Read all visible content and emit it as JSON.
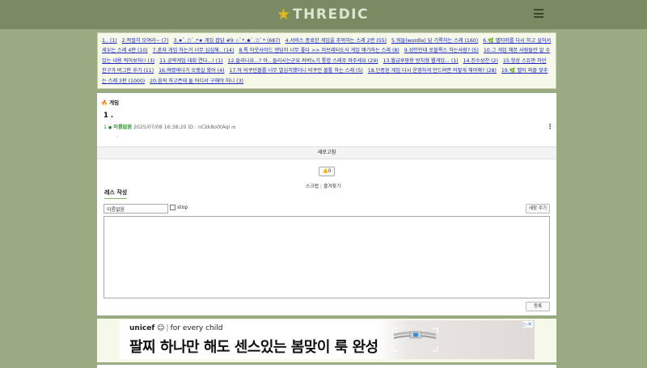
{
  "header": {
    "site_name": "THREDIC",
    "logo_icon": "star-icon",
    "menu_icon": "hamburger-icon"
  },
  "thread_list": [
    "1.. (1)",
    "2.적절히 모여라~ (7)",
    "3.★ﾟ.☆ﾟ.*★ 게임 잡담 #9 ☆ﾟ*.★ﾟ.☆ﾟ* (687)",
    "4.서비스 종료한 게임을 추억하는 스레 2판 (55)",
    "5.워들(wordle) 답 기록하는 스레 (160)",
    "6.🌿 멜티떠를 다시 하고 싶어서 세우는 스레 4판 (10)",
    "7.혼자 게임 하는거 너무 심심해.. (14)",
    "8.톡 아웃사이드 엔딩이 너무 좋다 >> 러브레터도식 게임 얘기하는 스레 (8)",
    "9.성인인데 로블록스 하는사람? (5)",
    "10.그 게임 해본 사람들만 알 수 있는 내용 적어보자!! (3)",
    "11.공략게임 대회 연다...! (1)",
    "12.들리나요...? 아.. 들리시는군요 커버노기 통합 스레로 와주세요 (29)",
    "13.월급루팡용 방치형 웹게임... (1)",
    "14.진수성찬 (2)",
    "15.항상 스듀판 하던 친구가 버그판 후기 (11)",
    "16.여렸바다가 오랫실 왔어 (4)",
    "17.아 비쿠민볼를 너무 열심히했더니 비쿠민 볼톨 하는 스레 (5)",
    "18.단종된 게임 다시 운영하게 만드려면 어떻게 해야해? (28)",
    "19.🌿 멜티 퍼즐 맞추는 스레 3판 (1000)",
    "20.음직 하고픈데 둘 어디서 구해야 하니 (3)"
  ],
  "post": {
    "board": "게임",
    "board_icon": "fire-icon",
    "title": "1 .",
    "res_no": "1",
    "res_mark": "●",
    "author": "이름없음",
    "meta": "2025/07/08 16:38:20 ID : nCkk8o0tAqi",
    "meta_suffix": "rb",
    "body": "."
  },
  "controls": {
    "refresh": "새로고침",
    "like_icon": "thumbs-up-icon",
    "like_count": "0",
    "scrap": "스크랩",
    "bookmark": "즐겨찾기",
    "divider": "|",
    "write_title": "레스 작성",
    "name_value": "이름없음",
    "stop_label": "stop",
    "new_window": "새창 주기",
    "submit": "등록"
  },
  "ad": {
    "brand": "unicef",
    "tagline": "for every child",
    "divider": "|",
    "headline": "팔찌 하나만 해도 센스있는 봄맞이 룩 완성",
    "adchoices": "▷✕"
  }
}
